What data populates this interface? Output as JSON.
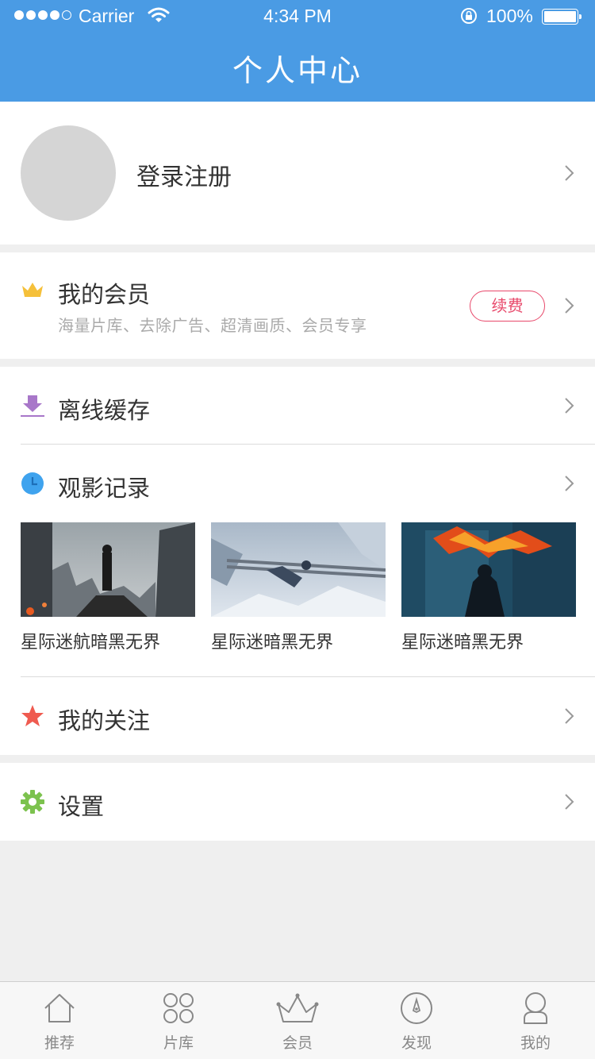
{
  "status_bar": {
    "carrier": "Carrier",
    "time": "4:34 PM",
    "battery": "100%"
  },
  "header": {
    "title": "个人中心"
  },
  "profile": {
    "login_label": "登录注册"
  },
  "member": {
    "title": "我的会员",
    "subtitle": "海量片库、去除广告、超清画质、会员专享",
    "renew_label": "续费",
    "icon": "crown-icon",
    "icon_color": "#f5c03a"
  },
  "offline": {
    "label": "离线缓存",
    "icon": "download-icon",
    "icon_color": "#a877c9"
  },
  "history": {
    "label": "观影记录",
    "icon": "clock-icon",
    "icon_color": "#3fa3ee",
    "items": [
      {
        "caption": "星际迷航暗黑无界"
      },
      {
        "caption": "星际迷暗黑无界"
      },
      {
        "caption": "星际迷暗黑无界"
      }
    ]
  },
  "follow": {
    "label": "我的关注",
    "icon": "star-icon",
    "icon_color": "#ef5b50"
  },
  "settings": {
    "label": "设置",
    "icon": "gear-icon",
    "icon_color": "#7cc24e"
  },
  "tabbar": {
    "tabs": [
      {
        "label": "推荐",
        "icon": "home-icon"
      },
      {
        "label": "片库",
        "icon": "grid-icon"
      },
      {
        "label": "会员",
        "icon": "crown-icon"
      },
      {
        "label": "发现",
        "icon": "compass-icon"
      },
      {
        "label": "我的",
        "icon": "user-icon"
      }
    ]
  },
  "colors": {
    "primary": "#4a9be4",
    "background": "#efefef",
    "accent_pink": "#e8496b"
  }
}
